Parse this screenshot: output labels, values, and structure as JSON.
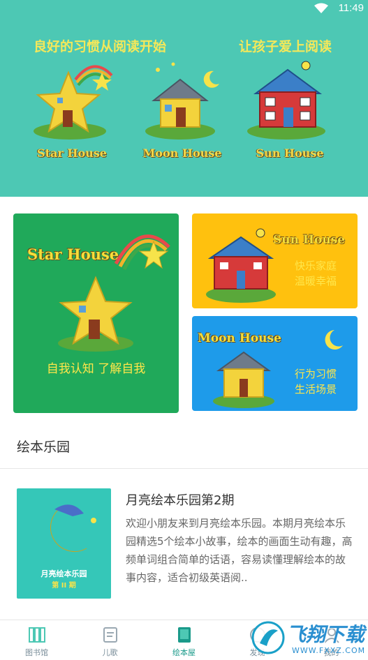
{
  "status": {
    "time": "11:49"
  },
  "banner": {
    "slogan_left": "良好的习惯从阅读开始",
    "slogan_right": "让孩子爱上阅读",
    "houses": [
      "Star House",
      "Moon House",
      "Sun House"
    ]
  },
  "cards": {
    "star": {
      "title": "Star House",
      "subtitle": "自我认知  了解自我"
    },
    "sun": {
      "title": "Sun House",
      "line1": "快乐家庭",
      "line2": "温暖幸福"
    },
    "moon": {
      "title": "Moon House",
      "line1": "行为习惯",
      "line2": "生活场景"
    }
  },
  "section": {
    "title": "绘本乐园"
  },
  "book": {
    "cover_title": "月亮绘本乐园",
    "cover_issue": "第 II 期",
    "title": "月亮绘本乐园第2期",
    "description": "欢迎小朋友来到月亮绘本乐园。本期月亮绘本乐园精选5个绘本小故事，绘本的画面生动有趣，高频单词组合简单的话语，容易读懂理解绘本的故事内容，适合初级英语阅.."
  },
  "tabs": [
    {
      "label": "图书馆",
      "active": false
    },
    {
      "label": "儿歌",
      "active": false
    },
    {
      "label": "绘本屋",
      "active": true
    },
    {
      "label": "发现",
      "active": false
    },
    {
      "label": "我的",
      "active": false
    }
  ],
  "watermark": {
    "brand": "飞翔下载",
    "site": "WWW.FXXZ.COM"
  },
  "colors": {
    "teal": "#4dc8b4",
    "green_card": "#20a95a",
    "yellow_card": "#ffc10e",
    "blue_card": "#1e9bea"
  }
}
